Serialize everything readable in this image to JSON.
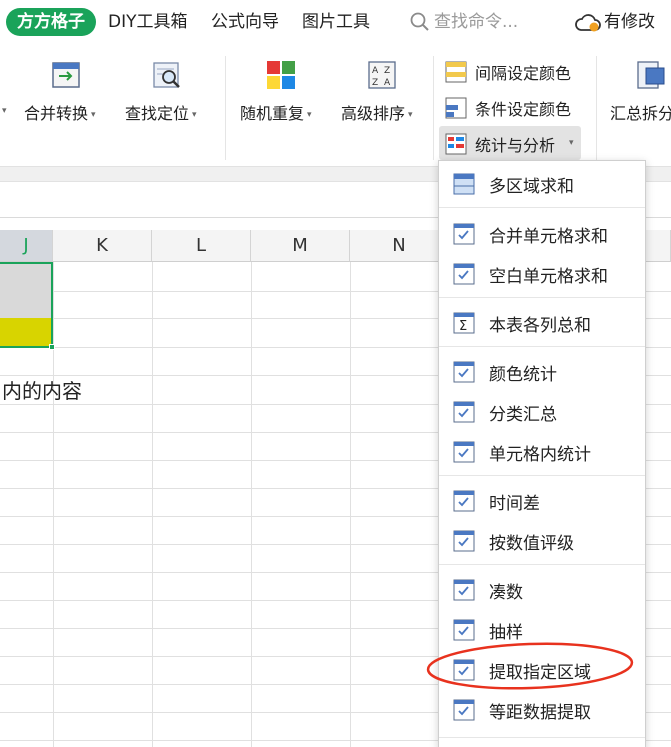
{
  "tabbar": {
    "active_tab": "方方格子",
    "tabs": [
      "DIY工具箱",
      "公式向导",
      "图片工具"
    ],
    "search_placeholder": "查找命令...",
    "status_text": "有修改"
  },
  "ribbon": {
    "buttons": [
      {
        "label": "合并转换",
        "icon": "merge-convert-icon"
      },
      {
        "label": "查找定位",
        "icon": "find-locate-icon"
      },
      {
        "label": "随机重复",
        "icon": "random-repeat-icon"
      },
      {
        "label": "高级排序",
        "icon": "advanced-sort-icon"
      }
    ],
    "small_buttons": [
      {
        "label": "间隔设定颜色",
        "icon": "interval-color-icon"
      },
      {
        "label": "条件设定颜色",
        "icon": "condition-color-icon"
      },
      {
        "label": "统计与分析",
        "icon": "statistics-icon"
      }
    ],
    "partial_button": "汇总拆分"
  },
  "grid": {
    "columns": [
      "J",
      "K",
      "L",
      "M",
      "N"
    ],
    "selected_column": "J",
    "cell_text": "内的内容",
    "colors": {
      "gray_cell": "#d9d9d9",
      "yellow_cell": "#d8d400",
      "selection": "#1aa35a"
    }
  },
  "menu": {
    "items": [
      {
        "label": "多区域求和",
        "icon": "multi-area-sum-icon"
      },
      {
        "label": "合并单元格求和",
        "icon": "merged-cell-sum-icon"
      },
      {
        "label": "空白单元格求和",
        "icon": "blank-cell-sum-icon"
      },
      {
        "label": "本表各列总和",
        "icon": "sigma-icon"
      },
      {
        "label": "颜色统计",
        "icon": "color-stat-icon"
      },
      {
        "label": "分类汇总",
        "icon": "category-summary-icon"
      },
      {
        "label": "单元格内统计",
        "icon": "in-cell-stat-icon"
      },
      {
        "label": "时间差",
        "icon": "time-diff-icon"
      },
      {
        "label": "按数值评级",
        "icon": "value-rating-icon"
      },
      {
        "label": "凑数",
        "icon": "make-up-number-icon"
      },
      {
        "label": "抽样",
        "icon": "sampling-icon"
      },
      {
        "label": "提取指定区域",
        "icon": "extract-area-icon"
      },
      {
        "label": "等距数据提取",
        "icon": "equidistant-extract-icon"
      }
    ],
    "highlighted_item": "提取指定区域",
    "highlight_color": "#e8321e"
  }
}
